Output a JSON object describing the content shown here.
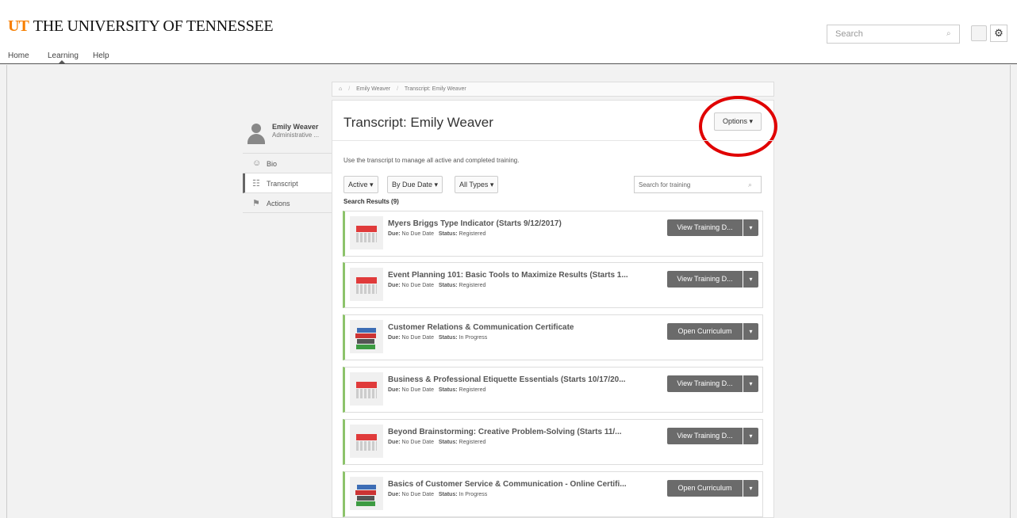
{
  "header": {
    "logo_mark": "UT",
    "brand_name": "THE UNIVERSITY OF TENNESSEE",
    "search_placeholder": "Search",
    "search_icon": "⌕",
    "gear_icon": "⚙"
  },
  "nav": {
    "items": [
      {
        "label": "Home"
      },
      {
        "label": "Learning"
      },
      {
        "label": "Help"
      }
    ]
  },
  "breadcrumb": {
    "home_icon": "⌂",
    "items": [
      "Emily Weaver",
      "Transcript: Emily Weaver"
    ]
  },
  "profile": {
    "name": "Emily Weaver",
    "title": "Administrative ..."
  },
  "side_menu": [
    {
      "label": "Bio",
      "icon": "☺"
    },
    {
      "label": "Transcript",
      "icon": "☷"
    },
    {
      "label": "Actions",
      "icon": "⚑"
    }
  ],
  "main": {
    "title": "Transcript: Emily Weaver",
    "options_label": "Options ▾",
    "description": "Use the transcript to manage all active and completed training.",
    "filters": [
      "Active ▾",
      "By Due Date ▾",
      "All Types ▾"
    ],
    "search_placeholder": "Search for training",
    "search_icon": "⌕",
    "results_count": "Search Results (9)"
  },
  "trainings": [
    {
      "title": "Myers Briggs Type Indicator (Starts 9/12/2017)",
      "due_label": "Due:",
      "due": "No Due Date",
      "status_label": "Status:",
      "status": "Registered",
      "action": "View Training D...",
      "type": "event"
    },
    {
      "title": "Event Planning 101: Basic Tools to Maximize Results (Starts 1...",
      "due_label": "Due:",
      "due": "No Due Date",
      "status_label": "Status:",
      "status": "Registered",
      "action": "View Training D...",
      "type": "event"
    },
    {
      "title": "Customer Relations & Communication Certificate",
      "due_label": "Due:",
      "due": "No Due Date",
      "status_label": "Status:",
      "status": "In Progress",
      "action": "Open Curriculum",
      "type": "curriculum"
    },
    {
      "title": "Business & Professional Etiquette Essentials (Starts 10/17/20...",
      "due_label": "Due:",
      "due": "No Due Date",
      "status_label": "Status:",
      "status": "Registered",
      "action": "View Training D...",
      "type": "event"
    },
    {
      "title": "Beyond Brainstorming: Creative Problem-Solving (Starts 11/...",
      "due_label": "Due:",
      "due": "No Due Date",
      "status_label": "Status:",
      "status": "Registered",
      "action": "View Training D...",
      "type": "event"
    },
    {
      "title": "Basics of Customer Service & Communication - Online Certifi...",
      "due_label": "Due:",
      "due": "No Due Date",
      "status_label": "Status:",
      "status": "In Progress",
      "action": "Open Curriculum",
      "type": "curriculum"
    }
  ],
  "colors": {
    "brand_orange": "#f77f00",
    "accent_green": "#8dc36b",
    "button_gray": "#6b6b6b",
    "highlight_red": "#e00000"
  }
}
